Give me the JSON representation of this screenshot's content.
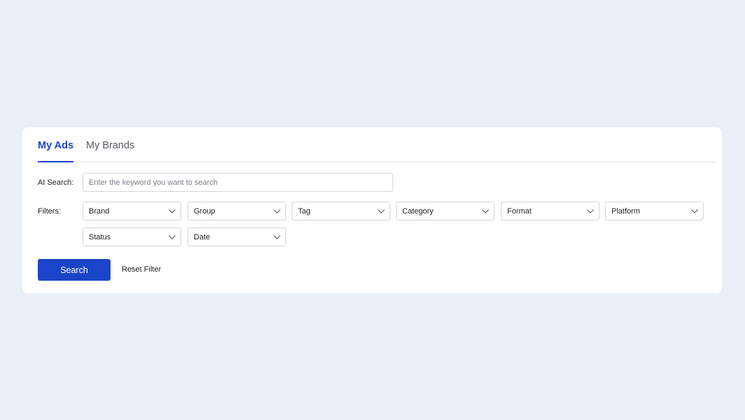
{
  "tabs": [
    {
      "label": "My Ads",
      "active": true
    },
    {
      "label": "My Brands",
      "active": false
    }
  ],
  "ai_search": {
    "label": "AI Search:",
    "placeholder": "Enter the keyword you want to search",
    "value": ""
  },
  "filters": {
    "label": "Filters:",
    "items": [
      {
        "label": "Brand"
      },
      {
        "label": "Group"
      },
      {
        "label": "Tag"
      },
      {
        "label": "Category"
      },
      {
        "label": "Format"
      },
      {
        "label": "Platform"
      },
      {
        "label": "Status"
      },
      {
        "label": "Date"
      }
    ]
  },
  "actions": {
    "search_label": "Search",
    "reset_label": "Reset Filter"
  },
  "colors": {
    "accent": "#1b45c8",
    "background": "#ebeff7",
    "card": "#ffffff"
  }
}
